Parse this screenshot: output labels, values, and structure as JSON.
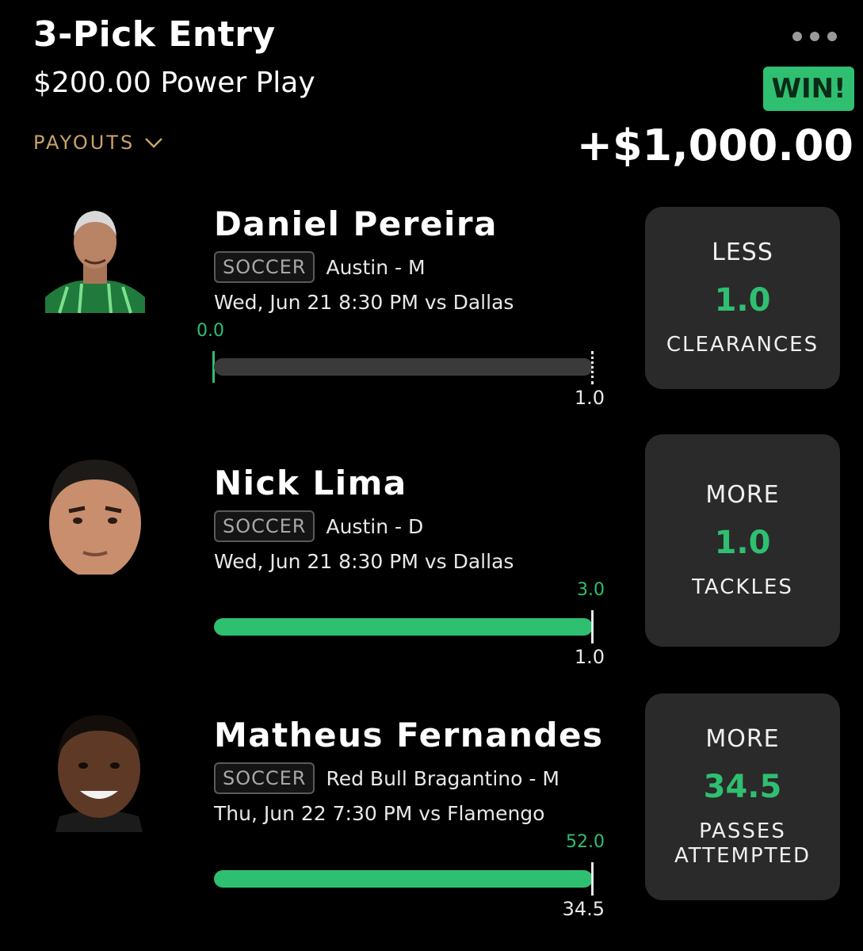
{
  "header": {
    "title": "3-Pick Entry",
    "subtitle": "$200.00 Power Play",
    "payouts_label": "PAYOUTS",
    "status_badge": "WIN!",
    "total": "+$1,000.00"
  },
  "colors": {
    "accent": "#2fbf71",
    "payouts": "#c9a36b",
    "card": "#2a2a2a",
    "background": "#000000"
  },
  "picks": [
    {
      "name": "Daniel Pereira",
      "sport": "SOCCER",
      "team": "Austin - M",
      "when": "Wed, Jun 21 8:30 PM  vs Dallas",
      "result": "0.0",
      "line_label": "1.0",
      "progress": 0.0,
      "direction": "LESS",
      "line": "1.0",
      "stat": "CLEARANCES"
    },
    {
      "name": "Nick Lima",
      "sport": "SOCCER",
      "team": "Austin - D",
      "when": "Wed, Jun 21 8:30 PM  vs Dallas",
      "result": "3.0",
      "line_label": "1.0",
      "progress": 1.0,
      "direction": "MORE",
      "line": "1.0",
      "stat": "TACKLES"
    },
    {
      "name": "Matheus Fernandes",
      "sport": "SOCCER",
      "team": "Red Bull Bragantino - M",
      "when": "Thu, Jun 22 7:30 PM  vs Flamengo",
      "result": "52.0",
      "line_label": "34.5",
      "progress": 1.0,
      "direction": "MORE",
      "line": "34.5",
      "stat": "PASSES ATTEMPTED"
    }
  ]
}
